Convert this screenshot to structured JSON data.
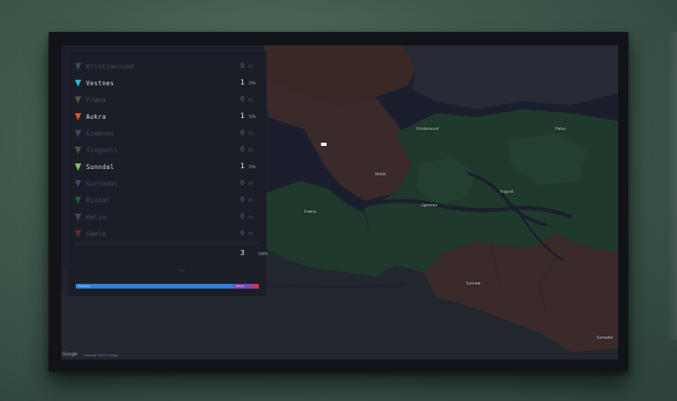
{
  "legend": {
    "rows": [
      {
        "name": "Kristiansund",
        "count": "0",
        "pct": "0%",
        "color": "#5b7fbf",
        "active": false
      },
      {
        "name": "Vestnes",
        "count": "1",
        "pct": "33%",
        "color": "#29b6c9",
        "active": true
      },
      {
        "name": "Fræna",
        "count": "0",
        "pct": "0%",
        "color": "#6aa86a",
        "active": false
      },
      {
        "name": "Aukra",
        "count": "1",
        "pct": "33%",
        "color": "#e0552c",
        "active": true
      },
      {
        "name": "Gjemnes",
        "count": "0",
        "pct": "0%",
        "color": "#5b7fbf",
        "active": false
      },
      {
        "name": "Tingvoll",
        "count": "0",
        "pct": "0%",
        "color": "#6aa86a",
        "active": false
      },
      {
        "name": "Sunndal",
        "count": "1",
        "pct": "33%",
        "color": "#7fc36f",
        "active": true
      },
      {
        "name": "Surnadal",
        "count": "0",
        "pct": "0%",
        "color": "#5b7fbf",
        "active": false
      },
      {
        "name": "Rindal",
        "count": "0",
        "pct": "0%",
        "color": "#3aa06b",
        "active": false
      },
      {
        "name": "Halsa",
        "count": "0",
        "pct": "0%",
        "color": "#8a6bb8",
        "active": false
      },
      {
        "name": "Smøla",
        "count": "0",
        "pct": "0%",
        "color": "#c2413b",
        "active": false
      }
    ],
    "total_count": "3",
    "total_pct": "100%"
  },
  "progress": {
    "segments": [
      {
        "label": "Vestnes",
        "fraction": 0.86,
        "color": "#2f80d6"
      },
      {
        "label": "Aukra",
        "fraction": 0.11,
        "color": "#7b49b8"
      },
      {
        "label": "",
        "fraction": 0.03,
        "color": "#d0334a"
      }
    ]
  },
  "map": {
    "labels": [
      "Kristiansund",
      "Molde",
      "Fræna",
      "Gjemnes",
      "Tingvoll",
      "Halsa",
      "Sunndal",
      "Surnadal"
    ]
  },
  "footer": {
    "logo": "Google",
    "attribution": "Kartdata ©2023 Google"
  }
}
